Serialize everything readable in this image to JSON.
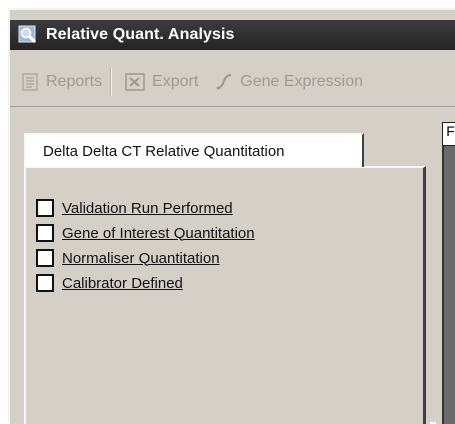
{
  "window": {
    "title": "Relative Quant. Analysis",
    "icon": "magnifier-window-icon"
  },
  "toolbar": {
    "reports_label": "Reports",
    "export_label": "Export",
    "gene_expression_label": "Gene Expression",
    "reports_icon": "report-icon",
    "export_icon": "export-icon",
    "gene_expression_icon": "gene-expression-icon"
  },
  "tabs": {
    "active_label": "Delta Delta CT Relative Quantitation",
    "right_tab_label": "F"
  },
  "checklist": {
    "items": [
      {
        "label": "Validation Run Performed",
        "checked": false
      },
      {
        "label": "Gene of Interest Quantitation",
        "checked": false
      },
      {
        "label": "Normaliser Quantitation",
        "checked": false
      },
      {
        "label": "Calibrator Defined",
        "checked": false
      }
    ]
  },
  "colors": {
    "titlebar": "#2f2f2f",
    "window_bg": "#d4d0c8",
    "disabled_text": "#9c9a96"
  }
}
